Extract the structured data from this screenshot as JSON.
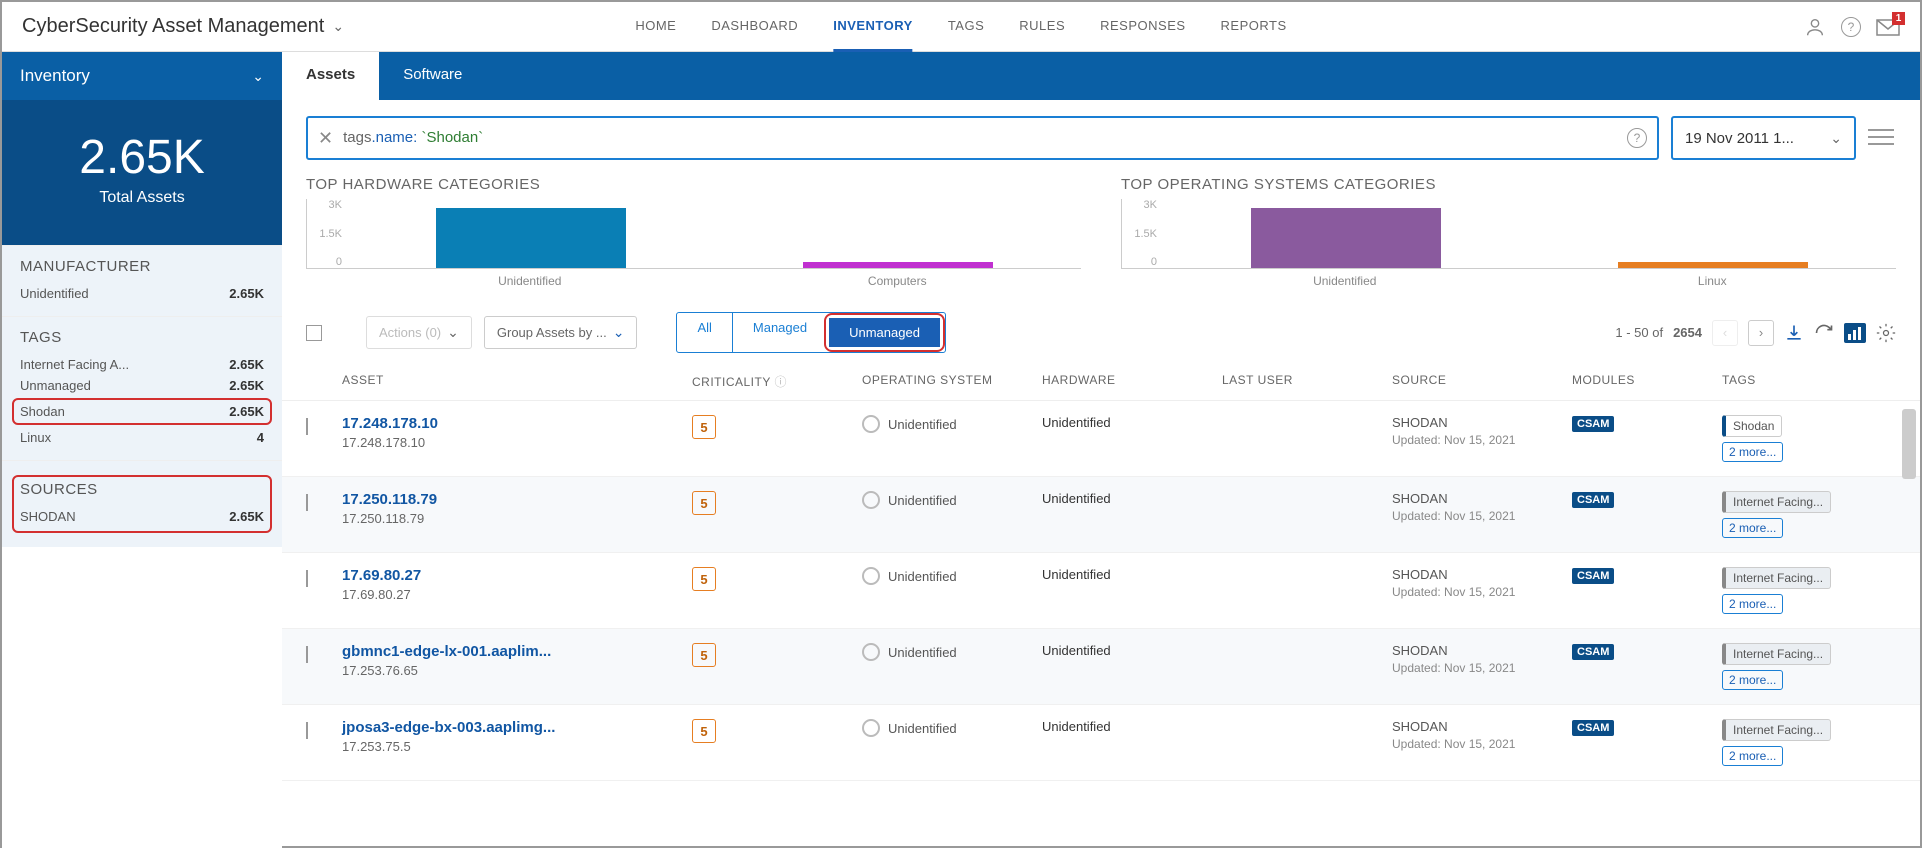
{
  "app": {
    "title": "CyberSecurity Asset Management"
  },
  "nav": [
    "HOME",
    "DASHBOARD",
    "INVENTORY",
    "TAGS",
    "RULES",
    "RESPONSES",
    "REPORTS"
  ],
  "nav_active": "INVENTORY",
  "mail_badge": "1",
  "sidebar": {
    "title": "Inventory",
    "summary_num": "2.65K",
    "summary_label": "Total Assets",
    "sections": [
      {
        "title": "MANUFACTURER",
        "rows": [
          {
            "label": "Unidentified",
            "val": "2.65K"
          }
        ]
      },
      {
        "title": "TAGS",
        "rows": [
          {
            "label": "Internet Facing A...",
            "val": "2.65K"
          },
          {
            "label": "Unmanaged",
            "val": "2.65K"
          },
          {
            "label": "Shodan",
            "val": "2.65K",
            "hl": true
          },
          {
            "label": "Linux",
            "val": "4"
          }
        ]
      },
      {
        "title": "SOURCES",
        "hl": true,
        "rows": [
          {
            "label": "SHODAN",
            "val": "2.65K"
          }
        ]
      }
    ]
  },
  "subtabs": [
    {
      "label": "Assets",
      "active": true
    },
    {
      "label": "Software"
    }
  ],
  "search": {
    "prefix": "tags",
    "mid": ".name:",
    "value": " `Shodan`"
  },
  "date_picker": "19 Nov 2011 1...",
  "charts": [
    {
      "title": "TOP HARDWARE CATEGORIES",
      "ticks": [
        "3K",
        "1.5K",
        "0"
      ],
      "bars": [
        {
          "label": "Unidentified",
          "h": 60,
          "color": "#0a7fb5"
        },
        {
          "label": "Computers",
          "h": 6,
          "color": "#c030d0"
        }
      ]
    },
    {
      "title": "TOP OPERATING SYSTEMS CATEGORIES",
      "ticks": [
        "3K",
        "1.5K",
        "0"
      ],
      "bars": [
        {
          "label": "Unidentified",
          "h": 60,
          "color": "#8a5a9e"
        },
        {
          "label": "Linux",
          "h": 6,
          "color": "#e67e22"
        }
      ]
    }
  ],
  "chart_data": [
    {
      "type": "bar",
      "title": "TOP HARDWARE CATEGORIES",
      "categories": [
        "Unidentified",
        "Computers"
      ],
      "values": [
        2650,
        200
      ],
      "ylim": [
        0,
        3000
      ],
      "ylabel": "",
      "xlabel": ""
    },
    {
      "type": "bar",
      "title": "TOP OPERATING SYSTEMS CATEGORIES",
      "categories": [
        "Unidentified",
        "Linux"
      ],
      "values": [
        2650,
        200
      ],
      "ylim": [
        0,
        3000
      ],
      "ylabel": "",
      "xlabel": ""
    }
  ],
  "toolbar": {
    "actions": "Actions (0)",
    "group": "Group Assets by ...",
    "seg": [
      "All",
      "Managed",
      "Unmanaged"
    ],
    "seg_active": "Unmanaged",
    "range": "1 - 50 of",
    "total": "2654"
  },
  "columns": [
    "ASSET",
    "CRITICALITY",
    "OPERATING SYSTEM",
    "HARDWARE",
    "LAST USER",
    "SOURCE",
    "MODULES",
    "TAGS"
  ],
  "rows": [
    {
      "name": "17.248.178.10",
      "ip": "17.248.178.10",
      "crit": "5",
      "os": "Unidentified",
      "hw": "Unidentified",
      "src": "SHODAN",
      "upd": "Updated: Nov 15, 2021",
      "mod": "CSAM",
      "tag": "Shodan",
      "tagcls": "blue",
      "more": "2 more..."
    },
    {
      "name": "17.250.118.79",
      "ip": "17.250.118.79",
      "crit": "5",
      "os": "Unidentified",
      "hw": "Unidentified",
      "src": "SHODAN",
      "upd": "Updated: Nov 15, 2021",
      "mod": "CSAM",
      "tag": "Internet Facing...",
      "tagcls": "grey",
      "more": "2 more..."
    },
    {
      "name": "17.69.80.27",
      "ip": "17.69.80.27",
      "crit": "5",
      "os": "Unidentified",
      "hw": "Unidentified",
      "src": "SHODAN",
      "upd": "Updated: Nov 15, 2021",
      "mod": "CSAM",
      "tag": "Internet Facing...",
      "tagcls": "grey",
      "more": "2 more..."
    },
    {
      "name": "gbmnc1-edge-lx-001.aaplim...",
      "ip": "17.253.76.65",
      "crit": "5",
      "os": "Unidentified",
      "hw": "Unidentified",
      "src": "SHODAN",
      "upd": "Updated: Nov 15, 2021",
      "mod": "CSAM",
      "tag": "Internet Facing...",
      "tagcls": "grey",
      "more": "2 more..."
    },
    {
      "name": "jposa3-edge-bx-003.aaplimg...",
      "ip": "17.253.75.5",
      "crit": "5",
      "os": "Unidentified",
      "hw": "Unidentified",
      "src": "SHODAN",
      "upd": "Updated: Nov 15, 2021",
      "mod": "CSAM",
      "tag": "Internet Facing...",
      "tagcls": "grey",
      "more": "2 more..."
    }
  ]
}
